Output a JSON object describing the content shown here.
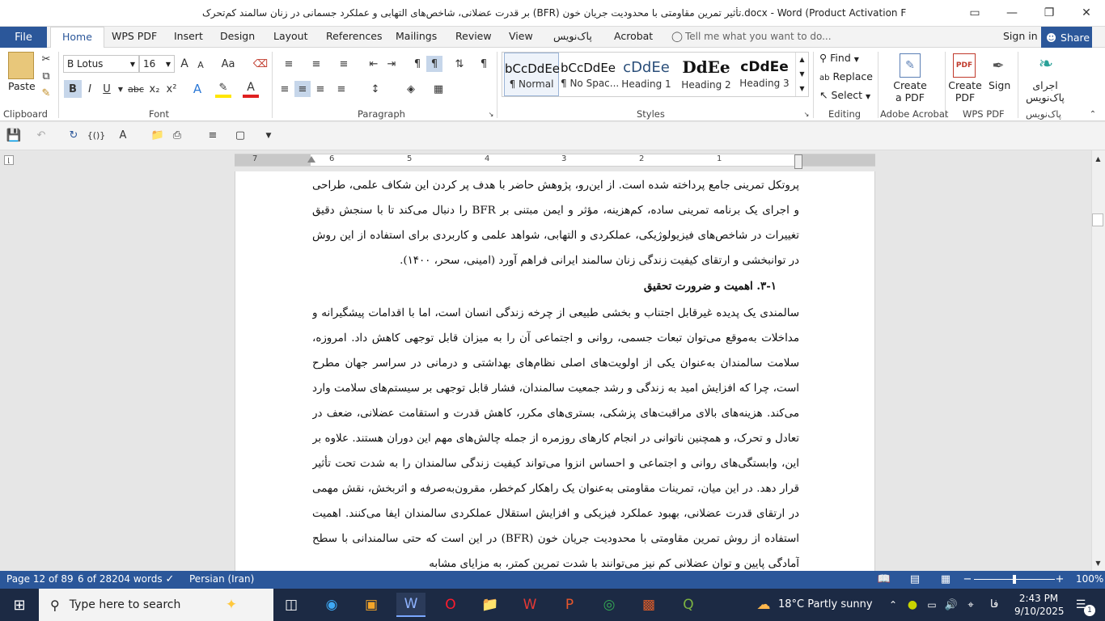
{
  "window": {
    "title": "بر قدرت عضلانی، شاخص‌های التهابی و عملکرد جسمانی در زنان سالمند کم‌تحرک (BFR) تأثیر تمرین مقاومتی با محدودیت جریان خون.docx - Word (Product Activation Failed)",
    "restore_icon": "▭",
    "minimize_icon": "—",
    "maximize_icon": "❐",
    "close_icon": "✕"
  },
  "menu": {
    "file": "File",
    "tabs": [
      "Home",
      "WPS PDF",
      "Insert",
      "Design",
      "Layout",
      "References",
      "Mailings",
      "Review",
      "View",
      "پاک‌نویس",
      "Acrobat"
    ],
    "tell_me": "Tell me what you want to do...",
    "sign_in": "Sign in",
    "share": "Share"
  },
  "ribbon": {
    "clipboard": {
      "paste": "Paste",
      "label": "Clipboard"
    },
    "font": {
      "name": "B Lotus",
      "size": "16",
      "label": "Font",
      "bold": "B",
      "italic": "I",
      "underline": "U",
      "strike": "abc",
      "sub": "x₂",
      "sup": "x²",
      "grow": "A",
      "shrink": "A",
      "case": "Aa",
      "color_a": "A"
    },
    "paragraph": {
      "label": "Paragraph"
    },
    "styles": {
      "label": "Styles",
      "items": [
        {
          "sample": "bCcDdEe",
          "name": "¶ Normal"
        },
        {
          "sample": "bCcDdEe",
          "name": "¶ No Spac..."
        },
        {
          "sample": "cDdEe",
          "name": "Heading 1"
        },
        {
          "sample": "DdEe",
          "name": "Heading 2"
        },
        {
          "sample": "cDdEe",
          "name": "Heading 3"
        }
      ]
    },
    "editing": {
      "find": "Find",
      "replace": "Replace",
      "select": "Select",
      "label": "Editing"
    },
    "adobe": {
      "create_pdf_line1": "Create",
      "create_pdf_line2": "a PDF",
      "label": "Adobe Acrobat"
    },
    "wps": {
      "create_line1": "Create",
      "create_line2": "PDF",
      "sign": "Sign",
      "label": "WPS PDF"
    },
    "paknevis": {
      "run_line1": "اجرای",
      "run_line2": "پاک‌نویس",
      "label": "پاک‌نویس"
    }
  },
  "ruler": {
    "numbers": [
      "7",
      "6",
      "5",
      "4",
      "3",
      "2",
      "1"
    ]
  },
  "document": {
    "para1": "پروتکل تمرینی جامع پرداخته شده است. از این‌رو، پژوهش حاضر با هدف پر کردن این شکاف علمی، طراحی و اجرای یک برنامه تمرینی ساده، کم‌هزینه، مؤثر و ایمن مبتنی بر BFR را دنبال می‌کند تا با سنجش دقیق تغییرات در شاخص‌های فیزیولوژیکی، عملکردی و التهابی، شواهد علمی و کاربردی برای استفاده از این روش در توانبخشی و ارتقای کیفیت زندگی زنان سالمند ایرانی فراهم آورد (امینی، سحر، ۱۴۰۰).",
    "heading": "۳-۱. اهمیت و ضرورت تحقیق",
    "para2": "سالمندی یک پدیده غیرقابل اجتناب و بخشی طبیعی از چرخه زندگی انسان است، اما با اقدامات پیشگیرانه و مداخلات به‌موقع می‌توان تبعات جسمی، روانی و اجتماعی آن را به میزان قابل توجهی کاهش داد. امروزه، سلامت سالمندان به‌عنوان یکی از اولویت‌های اصلی نظام‌های بهداشتی و درمانی در سراسر جهان مطرح است، چرا که افزایش امید به زندگی و رشد جمعیت سالمندان، فشار قابل توجهی بر سیستم‌های سلامت وارد می‌کند. هزینه‌های بالای مراقبت‌های پزشکی، بستری‌های مکرر، کاهش قدرت و استقامت عضلانی، ضعف در تعادل و تحرک، و همچنین ناتوانی در انجام کارهای روزمره از جمله چالش‌های مهم این دوران هستند. علاوه بر این، وابستگی‌های روانی و اجتماعی و احساس انزوا می‌تواند کیفیت زندگی سالمندان را به شدت تحت تأثیر قرار دهد. در این میان، تمرینات مقاومتی به‌عنوان یک راهکار کم‌خطر، مقرون‌به‌صرفه و اثربخش، نقش مهمی در ارتقای قدرت عضلانی، بهبود عملکرد فیزیکی و افزایش استقلال عملکردی سالمندان ایفا می‌کنند. اهمیت استفاده از روش تمرین مقاومتی با محدودیت جریان خون (BFR) در این است که حتی سالمندانی با سطح آمادگی پایین و توان عضلانی کم نیز می‌توانند با شدت تمرین کمتر، به مزایای مشابه"
  },
  "status": {
    "page": "Page 12 of 89",
    "words": "6 of 28204 words",
    "language": "Persian (Iran)",
    "zoom": "100%",
    "zoom_fraction": 0.5
  },
  "taskbar": {
    "search_placeholder": "Type here to search",
    "weather": "18°C  Partly sunny",
    "lang": "فا",
    "time": "2:43 PM",
    "date": "9/10/2025",
    "notifications": "1"
  },
  "colors": {
    "accent": "#2b579a"
  }
}
